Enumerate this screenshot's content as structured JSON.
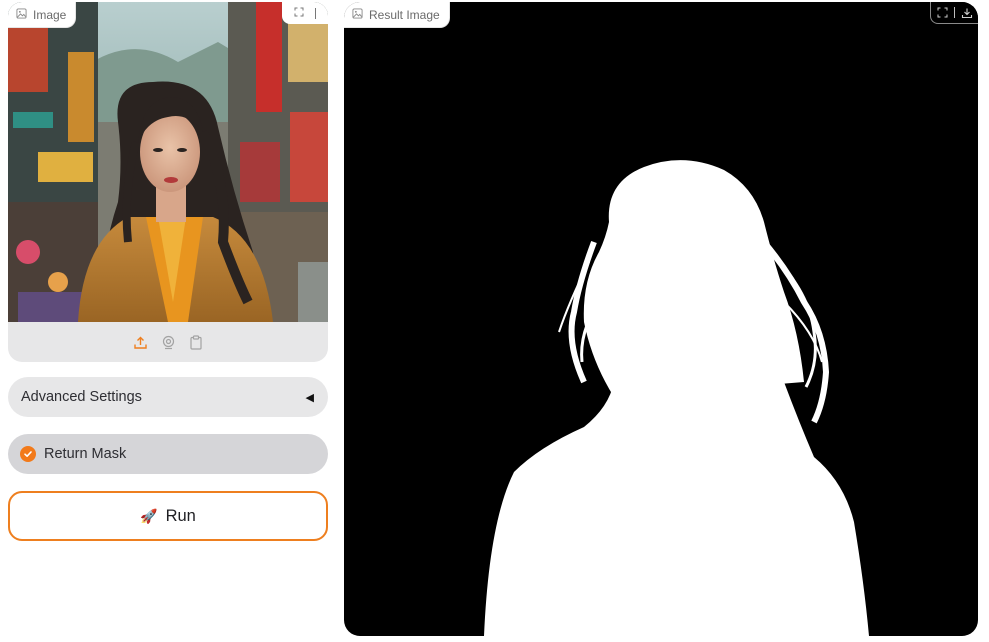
{
  "input_panel": {
    "label": "Image",
    "icons": [
      "image-icon",
      "upload-icon",
      "webcam-icon",
      "clipboard-icon"
    ]
  },
  "advanced_settings": {
    "label": "Advanced Settings",
    "toggle_glyph": "◀"
  },
  "return_mask": {
    "label": "Return Mask",
    "checked": true
  },
  "run_button": {
    "icon": "🚀",
    "label": "Run"
  },
  "result_panel": {
    "label": "Result Image",
    "icons": [
      "image-icon",
      "fullscreen-icon",
      "download-icon"
    ]
  },
  "colors": {
    "accent": "#ee7f1f",
    "panel_bg": "#e7e7e8",
    "result_bg": "#000000"
  }
}
